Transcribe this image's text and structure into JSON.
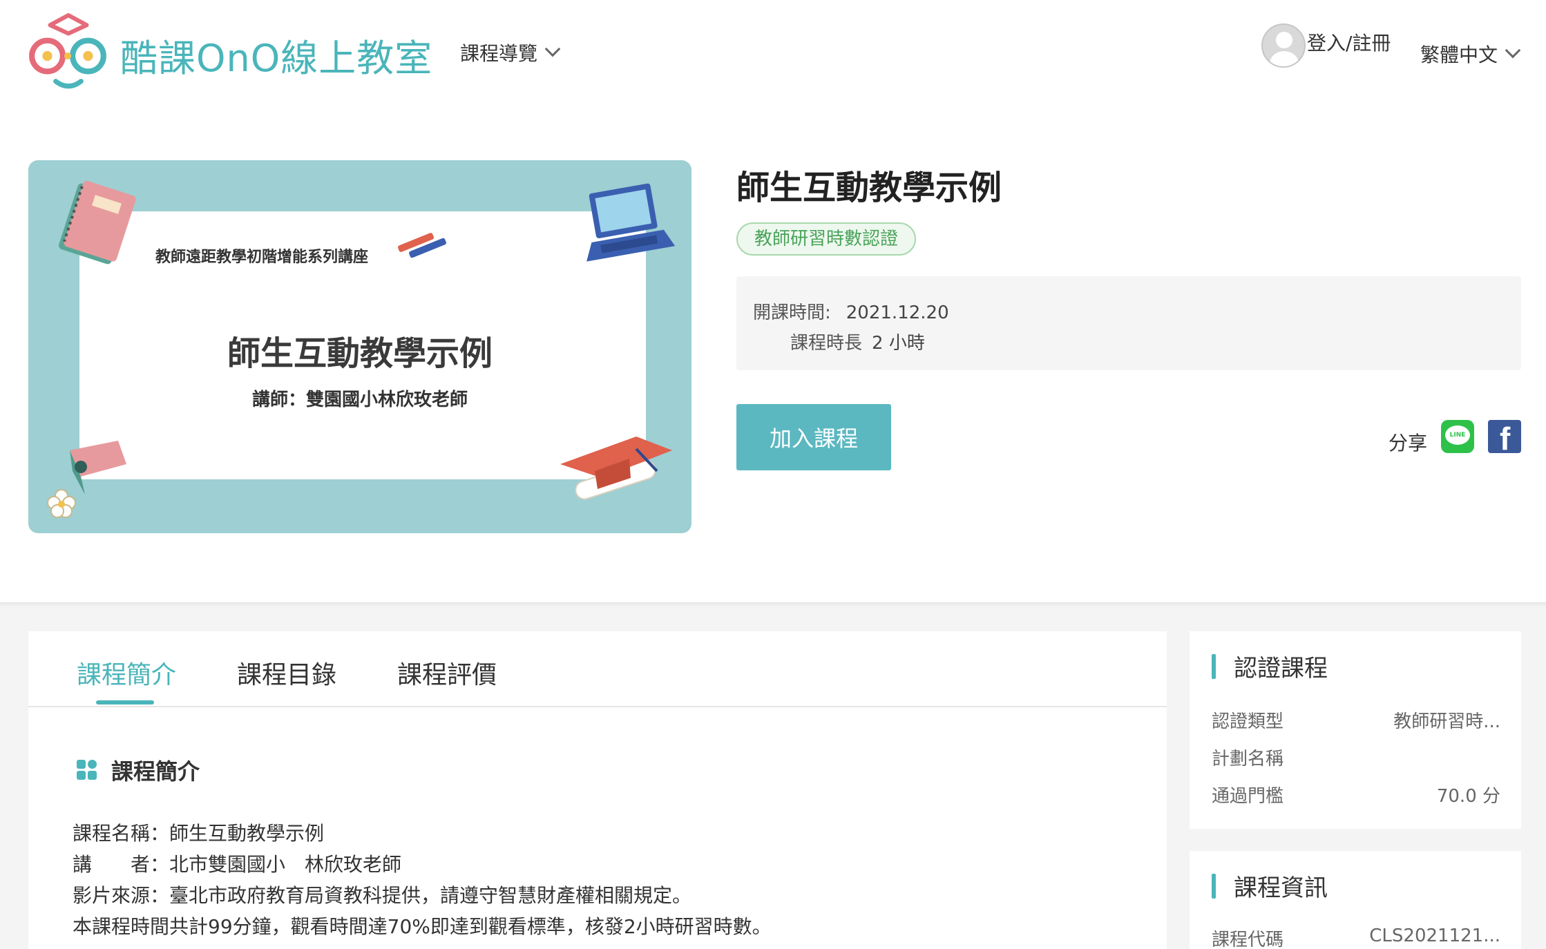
{
  "header": {
    "logo_text": "酷課OnO線上教室",
    "nav_browse": "課程導覽",
    "login": "登入/註冊",
    "language": "繁體中文"
  },
  "hero": {
    "series": "教師遠距教學初階增能系列講座",
    "title": "師生互動教學示例",
    "teacher": "講師：雙園國小林欣玫老師"
  },
  "course": {
    "title": "師生互動教學示例",
    "badge": "教師研習時數認證",
    "start_label": "開課時間:",
    "start_value": "2021.12.20",
    "duration_label": "課程時長",
    "duration_value": "2 小時",
    "join_button": "加入課程",
    "share_label": "分享",
    "line_text": "LINE"
  },
  "tabs": [
    {
      "label": "課程簡介",
      "active": true
    },
    {
      "label": "課程目錄",
      "active": false
    },
    {
      "label": "課程評價",
      "active": false
    }
  ],
  "intro": {
    "heading": "課程簡介",
    "lines": [
      "課程名稱：師生互動教學示例",
      "講　　者：北市雙園國小　林欣玫老師",
      "影片來源：臺北市政府教育局資教科提供，請遵守智慧財產權相關規定。",
      "本課程時間共計99分鐘，觀看時間達70%即達到觀看標準，核發2小時研習時數。"
    ]
  },
  "certification": {
    "title": "認證課程",
    "rows": [
      {
        "label": "認證類型",
        "value": "教師研習時..."
      },
      {
        "label": "計劃名稱",
        "value": ""
      },
      {
        "label": "通過門檻",
        "value": "70.0 分"
      }
    ]
  },
  "course_info": {
    "title": "課程資訊",
    "rows": [
      {
        "label": "課程代碼",
        "value": "CLS2021121..."
      }
    ]
  },
  "colors": {
    "accent": "#4ab5ba",
    "button": "#5bb8c1",
    "badge_green": "#4aa35a",
    "line_green": "#2ec14a",
    "facebook_blue": "#3b5998",
    "hero_bg": "#9dcfd3"
  }
}
